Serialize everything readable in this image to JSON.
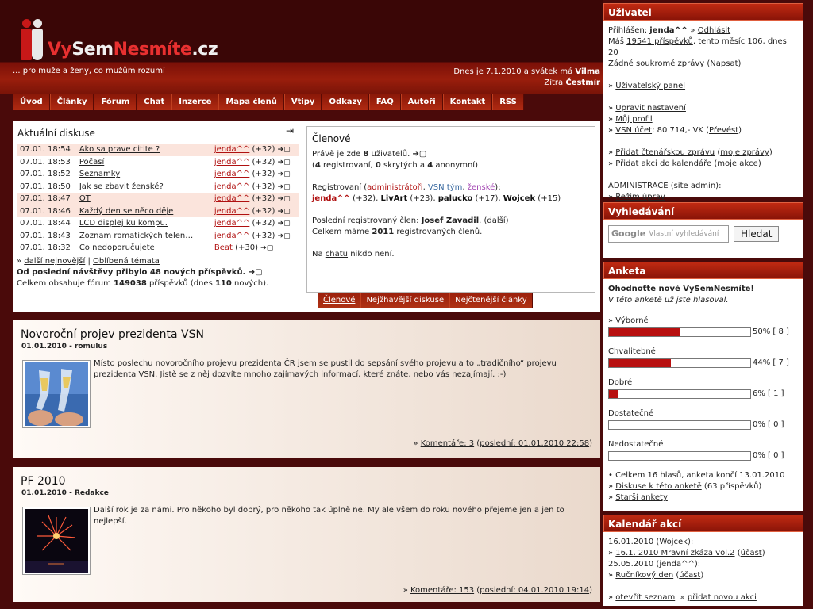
{
  "header": {
    "logo_text_vy": "Vy",
    "logo_text_sem": "Sem",
    "logo_text_nesmite": "Nesmíte",
    "logo_text_cz": ".cz",
    "tagline": "... pro muže a ženy, co mužům rozumí",
    "date_line": "Dnes je 7.1.2010 a svátek má",
    "date_name": "Vilma",
    "tomorrow_line": "Zítra",
    "tomorrow_name": "Čestmír"
  },
  "nav": [
    {
      "label": "Úvod",
      "struck": false
    },
    {
      "label": "Články",
      "struck": false
    },
    {
      "label": "Fórum",
      "struck": false
    },
    {
      "label": "Chat",
      "struck": true
    },
    {
      "label": "Inzerce",
      "struck": true
    },
    {
      "label": "Mapa členů",
      "struck": false
    },
    {
      "label": "Vtipy",
      "struck": true
    },
    {
      "label": "Odkazy",
      "struck": true
    },
    {
      "label": "FAQ",
      "struck": true
    },
    {
      "label": "Autoři",
      "struck": false
    },
    {
      "label": "Kontakt",
      "struck": true
    },
    {
      "label": "RSS",
      "struck": false
    }
  ],
  "discussions": {
    "title": "Aktuální diskuse",
    "rows": [
      {
        "time": "07.01. 18:54",
        "topic": "Ako sa prave citite ?",
        "user": "jenda^^",
        "count": "(+32)",
        "hl": true
      },
      {
        "time": "07.01. 18:53",
        "topic": "Počasí",
        "user": "jenda^^",
        "count": "(+32)",
        "hl": false
      },
      {
        "time": "07.01. 18:52",
        "topic": "Seznamky",
        "user": "jenda^^",
        "count": "(+32)",
        "hl": false
      },
      {
        "time": "07.01. 18:50",
        "topic": "Jak se zbavit ženské?",
        "user": "jenda^^",
        "count": "(+32)",
        "hl": false
      },
      {
        "time": "07.01. 18:47",
        "topic": "OT",
        "user": "jenda^^",
        "count": "(+32)",
        "hl": true
      },
      {
        "time": "07.01. 18:46",
        "topic": "Každý den se něco děje",
        "user": "jenda^^",
        "count": "(+32)",
        "hl": true
      },
      {
        "time": "07.01. 18:44",
        "topic": "LCD displej ku kompu.",
        "user": "jenda^^",
        "count": "(+32)",
        "hl": false
      },
      {
        "time": "07.01. 18:43",
        "topic": "Zoznam romatických telen…",
        "user": "jenda^^",
        "count": "(+32)",
        "hl": false
      },
      {
        "time": "07.01. 18:32",
        "topic": "Co nedoporučujete",
        "user": "Beat",
        "count": "(+30)",
        "hl": false
      }
    ],
    "more_prefix": "» ",
    "more_link": "další nejnovější",
    "sep": " | ",
    "fav_link": "Oblíbená témata",
    "since_last": "Od poslední návštěvy přibylo 48 nových příspěvků.",
    "total_prefix": "Celkem obsahuje fórum ",
    "total_count": "149038",
    "total_mid": " příspěvků (dnes ",
    "total_today": "110",
    "total_suffix": " nových)."
  },
  "members": {
    "title": "Členové",
    "now_prefix": "Právě je zde ",
    "now_count": "8",
    "now_suffix": " uživatelů.",
    "breakdown_a": "(",
    "reg": "4",
    "breakdown_b": " registrovaní, ",
    "hidden": "0",
    "breakdown_c": " skrytých a ",
    "anon": "4",
    "breakdown_d": " anonymní)",
    "registered_label": "Registrovaní (",
    "admins_label": "administrátoři",
    "comma1": ", ",
    "team_label": "VSN tým",
    "comma2": ", ",
    "women_label": "ženské",
    "registered_end": "):",
    "online_users": [
      {
        "name": "jenda^^",
        "count": " (+32), ",
        "color": "#b01010"
      },
      {
        "name": "LivArt",
        "count": " (+23), ",
        "color": "#111"
      },
      {
        "name": "palucko",
        "count": " (+17), ",
        "color": "#111"
      },
      {
        "name": "Wojcek",
        "count": " (+15)",
        "color": "#111"
      }
    ],
    "last_reg_prefix": "Poslední registrovaný člen: ",
    "last_reg_name": "Josef Zavadil",
    "last_reg_more": "další",
    "total_prefix": "Celkem máme ",
    "total_count": "2011",
    "total_suffix": " registrovaných členů.",
    "chat_prefix": "Na ",
    "chat_link": "chatu",
    "chat_suffix": " nikdo není.",
    "tabs": [
      "Členové",
      "Nejžhavější diskuse",
      "Nejčtenější články"
    ]
  },
  "articles": [
    {
      "title": "Novoroční projev prezidenta VSN",
      "meta": "01.01.2010 - romulus",
      "text": "Místo poslechu novoročního projevu prezidenta ČR jsem se pustil do sepsání svého projevu a to „tradičního“ projevu prezidenta VSN. Jistě se z něj dozvíte mnoho zajímavých informací, které znáte, nebo vás nezajímají. :-)",
      "comments": "Komentáře: 3",
      "last": "poslední: 01.01.2010 22:58"
    },
    {
      "title": "PF 2010",
      "meta": "01.01.2010 - Redakce",
      "text": "Další rok je za námi. Pro někoho byl dobrý, pro někoho tak úplně ne. My ale všem do roku nového přejeme jen a jen to nejlepší.",
      "comments": "Komentáře: 153",
      "last": "poslední: 04.01.2010 19:14"
    }
  ],
  "user_box": {
    "title": "Uživatel",
    "logged_prefix": "Přihlášen: ",
    "username": "jenda^^",
    "logout": "Odhlásit",
    "has_prefix": "Máš ",
    "posts": "19541 příspěvků",
    "posts_suffix": ", tento měsíc 106, dnes 20",
    "no_msgs": "Žádné soukromé zprávy (",
    "write": "Napsat",
    "user_panel": "Uživatelský panel",
    "settings": "Upravit nastavení",
    "profile": "Můj profil",
    "vsn_account": "VSN účet",
    "vsn_balance": ": 80 714,- VK (",
    "transfer": "Převést",
    "add_msg": "Přidat čtenářskou zprávu",
    "my_msgs": "moje zprávy",
    "add_event": "Přidat akci do kalendáře",
    "my_events": "moje akce",
    "admin_label": "ADMINISTRACE (site admin):",
    "edit_mode": "Režim úprav"
  },
  "search_box": {
    "title": "Vyhledávání",
    "placeholder": "Vlastní vyhledávání",
    "google": "Google",
    "button": "Hledat"
  },
  "poll_box": {
    "title": "Anketa",
    "question": "Ohodnoťte nové VySemNesmíte!",
    "voted": "V této anketě už jste hlasoval.",
    "options": [
      {
        "label": "Výborné",
        "pct": 50,
        "pct_text": "50% [ 8 ]"
      },
      {
        "label": "Chvalitebné",
        "pct": 44,
        "pct_text": "44% [ 7 ]"
      },
      {
        "label": "Dobré",
        "pct": 6,
        "pct_text": "6% [ 1 ]"
      },
      {
        "label": "Dostatečné",
        "pct": 0,
        "pct_text": "0% [ 0 ]"
      },
      {
        "label": "Nedostatečné",
        "pct": 0,
        "pct_text": "0% [ 0 ]"
      }
    ],
    "summary": "• Celkem 16 hlasů, anketa končí 13.01.2010",
    "discussion_link": "Diskuse k této anketě",
    "discussion_count": " (63 příspěvků)",
    "older_link": "Starší ankety"
  },
  "calendar_box": {
    "title": "Kalendář akcí",
    "date1": "16.01.2010 (Wojcek):",
    "event1": "16.1. 2010 Mravní zkáza vol.2",
    "join1": "účast",
    "date2": "25.05.2010 (jenda^^):",
    "event2": "Ručníkový den",
    "join2": "účast",
    "open_list": "otevřít seznam",
    "add_new": "přidat novou akci"
  },
  "colors": {
    "accent": "#b01010",
    "background": "#4a0a0a",
    "header_bar": "#9a1e0c"
  }
}
